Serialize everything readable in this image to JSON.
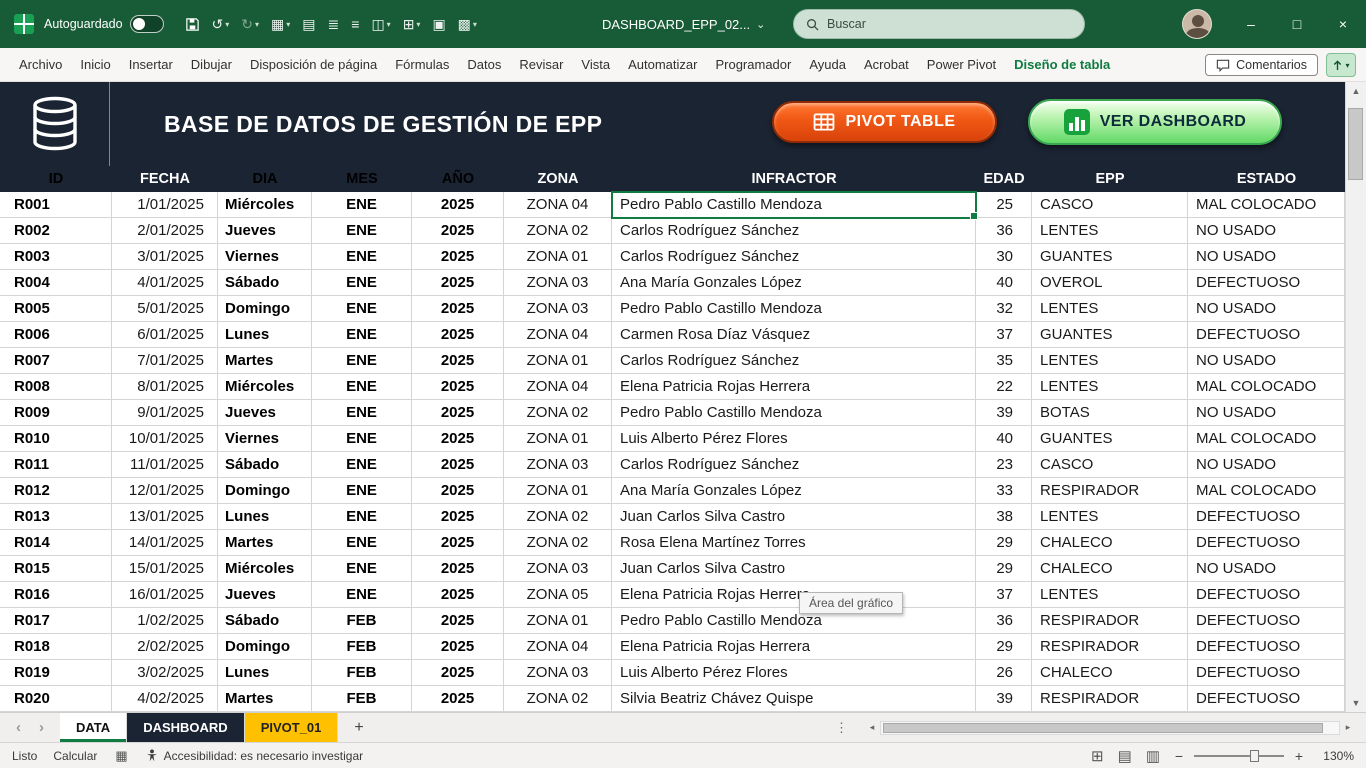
{
  "colors": {
    "excel_green": "#185C37",
    "navy_header": "#1B2433",
    "pivot_button_orange": "#E8430C",
    "dashboard_button_green": "#62DA66",
    "selection_green": "#107C41",
    "pivot_tab_gold": "#FFC000"
  },
  "titlebar": {
    "autosave_label": "Autoguardado",
    "doc_title": "DASHBOARD_EPP_02...",
    "search_placeholder": "Buscar",
    "undo_glyph": "↺",
    "redo_glyph": "↻",
    "qat_icons": [
      {
        "name": "borders-icon",
        "glyph": "▦",
        "caret": true
      },
      {
        "name": "paste-icon",
        "glyph": "▤",
        "caret": false
      },
      {
        "name": "align-top-icon",
        "glyph": "≣",
        "caret": false
      },
      {
        "name": "align-middle-icon",
        "glyph": "≡",
        "caret": false
      },
      {
        "name": "merge-cells-icon",
        "glyph": "◫",
        "caret": true
      },
      {
        "name": "number-format-icon",
        "glyph": "⊞",
        "caret": true
      },
      {
        "name": "insert-table-icon",
        "glyph": "▣",
        "caret": false
      },
      {
        "name": "insert-image-icon",
        "glyph": "▩",
        "caret": true
      }
    ],
    "window_controls": {
      "minimize": "–",
      "maximize": "□",
      "close": "×"
    }
  },
  "ribbon": {
    "tabs": [
      "Archivo",
      "Inicio",
      "Insertar",
      "Dibujar",
      "Disposición de página",
      "Fórmulas",
      "Datos",
      "Revisar",
      "Vista",
      "Automatizar",
      "Programador",
      "Ayuda",
      "Acrobat",
      "Power Pivot",
      "Diseño de tabla"
    ],
    "active_tab": "Diseño de tabla",
    "comments_label": "Comentarios"
  },
  "header": {
    "title": "BASE DE DATOS DE GESTIÓN DE EPP",
    "pivot_button_label": "PIVOT TABLE",
    "dashboard_button_label": "VER DASHBOARD"
  },
  "table": {
    "columns": [
      "ID",
      "FECHA",
      "DIA",
      "MES",
      "AÑO",
      "ZONA",
      "INFRACTOR",
      "EDAD",
      "EPP",
      "ESTADO"
    ],
    "selected": {
      "row": 0,
      "col": 6
    },
    "rows": [
      [
        "R001",
        "1/01/2025",
        "Miércoles",
        "ENE",
        "2025",
        "ZONA 04",
        "Pedro Pablo Castillo Mendoza",
        "25",
        "CASCO",
        "MAL COLOCADO"
      ],
      [
        "R002",
        "2/01/2025",
        "Jueves",
        "ENE",
        "2025",
        "ZONA 02",
        "Carlos Rodríguez Sánchez",
        "36",
        "LENTES",
        "NO USADO"
      ],
      [
        "R003",
        "3/01/2025",
        "Viernes",
        "ENE",
        "2025",
        "ZONA 01",
        "Carlos Rodríguez Sánchez",
        "30",
        "GUANTES",
        "NO USADO"
      ],
      [
        "R004",
        "4/01/2025",
        "Sábado",
        "ENE",
        "2025",
        "ZONA 03",
        "Ana María Gonzales López",
        "40",
        "OVEROL",
        "DEFECTUOSO"
      ],
      [
        "R005",
        "5/01/2025",
        "Domingo",
        "ENE",
        "2025",
        "ZONA 03",
        "Pedro Pablo Castillo Mendoza",
        "32",
        "LENTES",
        "NO USADO"
      ],
      [
        "R006",
        "6/01/2025",
        "Lunes",
        "ENE",
        "2025",
        "ZONA 04",
        "Carmen Rosa Díaz Vásquez",
        "37",
        "GUANTES",
        "DEFECTUOSO"
      ],
      [
        "R007",
        "7/01/2025",
        "Martes",
        "ENE",
        "2025",
        "ZONA 01",
        "Carlos Rodríguez Sánchez",
        "35",
        "LENTES",
        "NO USADO"
      ],
      [
        "R008",
        "8/01/2025",
        "Miércoles",
        "ENE",
        "2025",
        "ZONA 04",
        "Elena Patricia Rojas Herrera",
        "22",
        "LENTES",
        "MAL COLOCADO"
      ],
      [
        "R009",
        "9/01/2025",
        "Jueves",
        "ENE",
        "2025",
        "ZONA 02",
        "Pedro Pablo Castillo Mendoza",
        "39",
        "BOTAS",
        "NO USADO"
      ],
      [
        "R010",
        "10/01/2025",
        "Viernes",
        "ENE",
        "2025",
        "ZONA 01",
        "Luis Alberto Pérez Flores",
        "40",
        "GUANTES",
        "MAL COLOCADO"
      ],
      [
        "R011",
        "11/01/2025",
        "Sábado",
        "ENE",
        "2025",
        "ZONA 03",
        "Carlos Rodríguez Sánchez",
        "23",
        "CASCO",
        "NO USADO"
      ],
      [
        "R012",
        "12/01/2025",
        "Domingo",
        "ENE",
        "2025",
        "ZONA 01",
        "Ana María Gonzales López",
        "33",
        "RESPIRADOR",
        "MAL COLOCADO"
      ],
      [
        "R013",
        "13/01/2025",
        "Lunes",
        "ENE",
        "2025",
        "ZONA 02",
        "Juan Carlos Silva Castro",
        "38",
        "LENTES",
        "DEFECTUOSO"
      ],
      [
        "R014",
        "14/01/2025",
        "Martes",
        "ENE",
        "2025",
        "ZONA 02",
        "Rosa Elena Martínez Torres",
        "29",
        "CHALECO",
        "DEFECTUOSO"
      ],
      [
        "R015",
        "15/01/2025",
        "Miércoles",
        "ENE",
        "2025",
        "ZONA 03",
        "Juan Carlos Silva Castro",
        "29",
        "CHALECO",
        "NO USADO"
      ],
      [
        "R016",
        "16/01/2025",
        "Jueves",
        "ENE",
        "2025",
        "ZONA 05",
        "Elena Patricia Rojas Herrera",
        "37",
        "LENTES",
        "DEFECTUOSO"
      ],
      [
        "R017",
        "1/02/2025",
        "Sábado",
        "FEB",
        "2025",
        "ZONA 01",
        "Pedro Pablo Castillo Mendoza",
        "36",
        "RESPIRADOR",
        "DEFECTUOSO"
      ],
      [
        "R018",
        "2/02/2025",
        "Domingo",
        "FEB",
        "2025",
        "ZONA 04",
        "Elena Patricia Rojas Herrera",
        "29",
        "RESPIRADOR",
        "DEFECTUOSO"
      ],
      [
        "R019",
        "3/02/2025",
        "Lunes",
        "FEB",
        "2025",
        "ZONA 03",
        "Luis Alberto Pérez Flores",
        "26",
        "CHALECO",
        "DEFECTUOSO"
      ],
      [
        "R020",
        "4/02/2025",
        "Martes",
        "FEB",
        "2025",
        "ZONA 02",
        "Silvia Beatriz Chávez Quispe",
        "39",
        "RESPIRADOR",
        "DEFECTUOSO"
      ]
    ]
  },
  "tooltip": "Área del gráfico",
  "sheet_tabs": {
    "nav_prev": "‹",
    "nav_next": "›",
    "items": [
      "DATA",
      "DASHBOARD",
      "PIVOT_01"
    ],
    "active": "DATA",
    "add_label": "+",
    "dots": "⋮"
  },
  "status_bar": {
    "mode": "Listo",
    "calculate": "Calcular",
    "macro_glyph": "▦",
    "accessibility": "Accesibilidad: es necesario investigar",
    "view_icons": [
      {
        "name": "normal-view-icon",
        "glyph": "⊞"
      },
      {
        "name": "page-layout-view-icon",
        "glyph": "▤"
      },
      {
        "name": "page-break-view-icon",
        "glyph": "▥"
      }
    ],
    "zoom_out": "−",
    "zoom_in": "+",
    "zoom_level": "130%"
  }
}
